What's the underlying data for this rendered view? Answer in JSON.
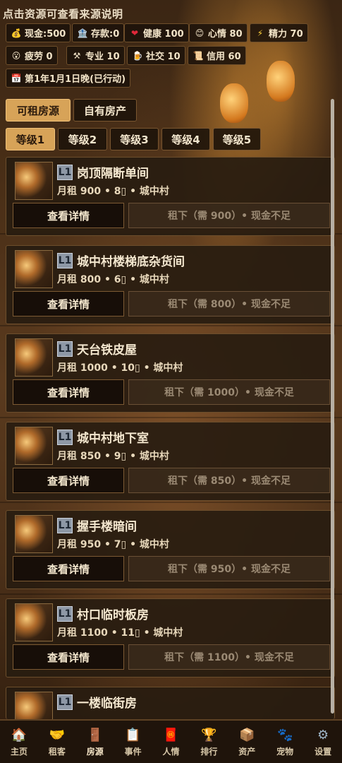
{
  "hint": "点击资源可查看来源说明",
  "stats": [
    {
      "icon": "money-bag-icon",
      "glyph": "💰",
      "label": "现金:500"
    },
    {
      "icon": "bank-icon",
      "glyph": "🏦",
      "label": "存款:0"
    },
    {
      "icon": "heart-icon",
      "glyph": "❤",
      "label": "健康 100"
    },
    {
      "icon": "smile-icon",
      "glyph": "😊",
      "label": "心情 80"
    },
    {
      "icon": "lightning-icon",
      "glyph": "⚡",
      "label": "精力 70"
    },
    {
      "icon": "tired-face-icon",
      "glyph": "😮",
      "label": "疲劳 0"
    },
    {
      "icon": "tools-icon",
      "glyph": "⚒",
      "label": "专业 10"
    },
    {
      "icon": "beer-icon",
      "glyph": "🍺",
      "label": "社交 10"
    },
    {
      "icon": "scroll-icon",
      "glyph": "📜",
      "label": "信用 60"
    },
    {
      "icon": "calendar-icon",
      "glyph": "📅",
      "label": "第1年1月1日晚(已行动)"
    }
  ],
  "tabs": [
    "可租房源",
    "自有房产"
  ],
  "levels": [
    "等级1",
    "等级2",
    "等级3",
    "等级4",
    "等级5"
  ],
  "listings": [
    {
      "level": "L1",
      "name": "岗顶隔断单间",
      "info": "月租 900 • 8▯ • 城中村",
      "detail": "查看详情",
      "rent": "租下（需 900）• 现金不足"
    },
    {
      "level": "L1",
      "name": "城中村楼梯底杂货间",
      "info": "月租 800 • 6▯ • 城中村",
      "detail": "查看详情",
      "rent": "租下（需 800）• 现金不足"
    },
    {
      "level": "L1",
      "name": "天台铁皮屋",
      "info": "月租 1000 • 10▯ • 城中村",
      "detail": "查看详情",
      "rent": "租下（需 1000）• 现金不足"
    },
    {
      "level": "L1",
      "name": "城中村地下室",
      "info": "月租 850 • 9▯ • 城中村",
      "detail": "查看详情",
      "rent": "租下（需 850）• 现金不足"
    },
    {
      "level": "L1",
      "name": "握手楼暗间",
      "info": "月租 950 • 7▯ • 城中村",
      "detail": "查看详情",
      "rent": "租下（需 950）• 现金不足"
    },
    {
      "level": "L1",
      "name": "村口临时板房",
      "info": "月租 1100 • 11▯ • 城中村",
      "detail": "查看详情",
      "rent": "租下（需 1100）• 现金不足"
    },
    {
      "level": "L1",
      "name": "一楼临街房",
      "info": "",
      "detail": "",
      "rent": ""
    }
  ],
  "nav": [
    {
      "icon": "home-icon",
      "glyph": "🏠",
      "label": "主页"
    },
    {
      "icon": "handshake-icon",
      "glyph": "🤝",
      "label": "租客"
    },
    {
      "icon": "door-icon",
      "glyph": "🚪",
      "label": "房源"
    },
    {
      "icon": "clipboard-icon",
      "glyph": "📋",
      "label": "事件"
    },
    {
      "icon": "red-envelope-icon",
      "glyph": "🧧",
      "label": "人情"
    },
    {
      "icon": "trophy-icon",
      "glyph": "🏆",
      "label": "排行"
    },
    {
      "icon": "box-icon",
      "glyph": "📦",
      "label": "资产"
    },
    {
      "icon": "paw-icon",
      "glyph": "🐾",
      "label": "宠物"
    },
    {
      "icon": "gear-icon",
      "glyph": "⚙",
      "label": "设置"
    }
  ]
}
